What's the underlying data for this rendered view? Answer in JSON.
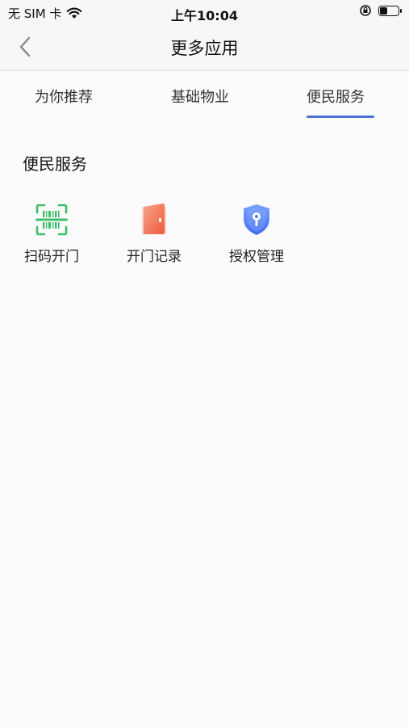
{
  "status_bar": {
    "carrier": "无 SIM 卡",
    "time": "上午10:04",
    "battery_level": 0.45
  },
  "nav": {
    "title": "更多应用"
  },
  "tabs": [
    {
      "label": "为你推荐",
      "active": false
    },
    {
      "label": "基础物业",
      "active": false
    },
    {
      "label": "便民服务",
      "active": true
    }
  ],
  "section": {
    "title": "便民服务",
    "items": [
      {
        "label": "扫码开门",
        "icon": "scan-qr-icon",
        "color": "#3cbf68"
      },
      {
        "label": "开门记录",
        "icon": "door-icon",
        "color": "#f06a4a"
      },
      {
        "label": "授权管理",
        "icon": "shield-key-icon",
        "color": "#4f7ef0"
      }
    ]
  },
  "colors": {
    "accent": "#4a72d6"
  }
}
